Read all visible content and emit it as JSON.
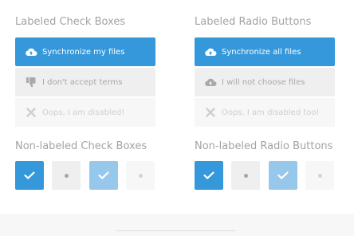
{
  "checkboxes": {
    "labeled_heading": "Labeled Check Boxes",
    "sync_label": "Synchronize my files",
    "decline_label": "I don't accept terms",
    "disabled_label": "Oops, I am disabled!",
    "nonlabeled_heading": "Non-labeled Check Boxes"
  },
  "radios": {
    "labeled_heading": "Labeled Radio Buttons",
    "sync_label": "Synchronize all files",
    "decline_label": "I will not choose files",
    "disabled_label": "Oops, I am disabled too!",
    "nonlabeled_heading": "Non-labeled Radio Buttons"
  },
  "icons": {
    "sync": "cloud-sync-icon",
    "thumbs_down": "thumbs-down-icon",
    "cloud": "cloud-icon",
    "disabled": "x-icon",
    "check": "check-icon",
    "dot": "dot-icon"
  },
  "colors": {
    "accent": "#3498db",
    "accent_light": "#97c8ec",
    "neutral": "#efefef",
    "disabled": "#f7f7f7",
    "heading": "#a3a3a3"
  }
}
